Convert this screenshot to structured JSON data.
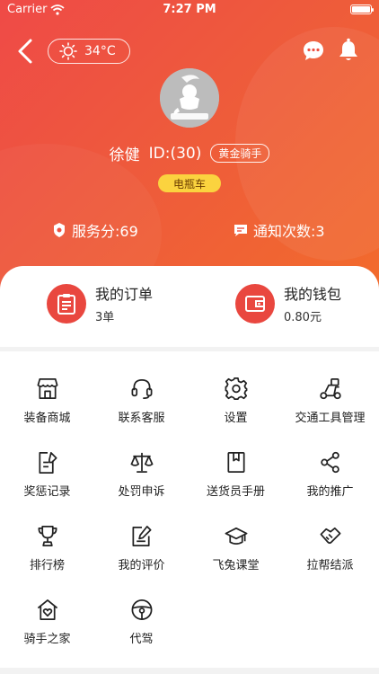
{
  "status_bar": {
    "carrier": "Carrier",
    "time": "7:27 PM"
  },
  "weather": {
    "temperature": "34°C"
  },
  "profile": {
    "name": "徐健",
    "id": "ID:(30)",
    "level_badge": "黄金骑手",
    "vehicle": "电瓶车"
  },
  "stats": {
    "service_score": "服务分:69",
    "notification_count": "通知次数:3"
  },
  "summary": {
    "orders": {
      "title": "我的订单",
      "value": "3单"
    },
    "wallet": {
      "title": "我的钱包",
      "value": "0.80元"
    }
  },
  "menu": [
    {
      "label": "装备商城",
      "icon": "store-icon"
    },
    {
      "label": "联系客服",
      "icon": "headset-icon"
    },
    {
      "label": "设置",
      "icon": "gear-icon"
    },
    {
      "label": "交通工具管理",
      "icon": "scooter-icon"
    },
    {
      "label": "奖惩记录",
      "icon": "edit-doc-icon"
    },
    {
      "label": "处罚申诉",
      "icon": "scale-icon"
    },
    {
      "label": "送货员手册",
      "icon": "book-icon"
    },
    {
      "label": "我的推广",
      "icon": "share-icon"
    },
    {
      "label": "排行榜",
      "icon": "trophy-icon"
    },
    {
      "label": "我的评价",
      "icon": "review-icon"
    },
    {
      "label": "飞兔课堂",
      "icon": "graduation-cap-icon"
    },
    {
      "label": "拉帮结派",
      "icon": "handshake-icon"
    },
    {
      "label": "骑手之家",
      "icon": "home-heart-icon"
    },
    {
      "label": "代驾",
      "icon": "steering-wheel-icon"
    }
  ],
  "colors": {
    "primary": "#ee4f41",
    "gold": "#fbd33f",
    "icon_red": "#e9473f"
  }
}
